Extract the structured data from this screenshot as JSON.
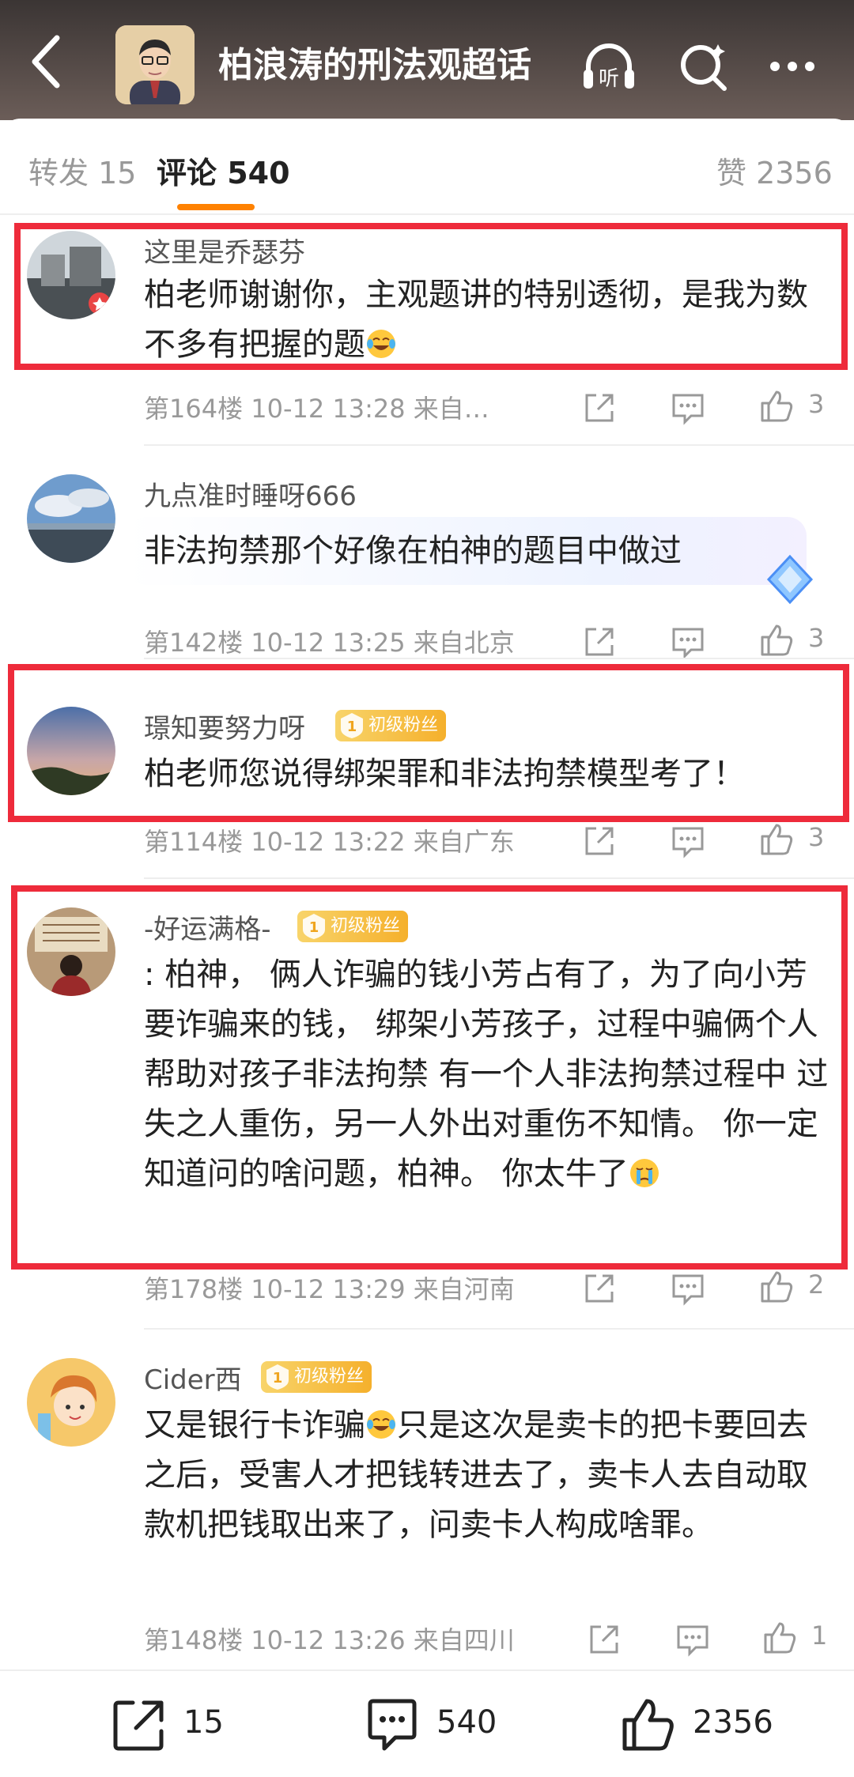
{
  "header": {
    "title": "柏浪涛的刑法观超话",
    "listen_label": "听"
  },
  "tabs": {
    "repost": "转发 15",
    "comment": "评论 540",
    "like": "赞 2356"
  },
  "comments": [
    {
      "username": "这里是乔瑟芬",
      "badge": "",
      "text": "柏老师谢谢你，主观题讲的特别透彻，是我为数不多有把握的题",
      "meta": "第164楼 10-12 13:28 来自…",
      "likes": "3"
    },
    {
      "username": "九点准时睡呀666",
      "badge": "",
      "text": "非法拘禁那个好像在柏神的题目中做过",
      "meta": "第142楼 10-12 13:25 来自北京",
      "likes": "3"
    },
    {
      "username": "璟知要努力呀",
      "badge": "初级粉丝",
      "badge_num": "1",
      "text": "柏老师您说得绑架罪和非法拘禁模型考了！",
      "meta": "第114楼 10-12 13:22 来自广东",
      "likes": "3"
    },
    {
      "username": "-好运满格-",
      "badge": "初级粉丝",
      "badge_num": "1",
      "text": ": 柏神，  俩人诈骗的钱小芳占有了，为了向小芳要诈骗来的钱，  绑架小芳孩子，过程中骗俩个人帮助对孩子非法拘禁      有一个人非法拘禁过程中 过失之人重伤，另一人外出对重伤不知情。      你一定知道问的啥问题，柏神。  你太牛了",
      "meta": "第178楼 10-12 13:29 来自河南",
      "likes": "2"
    },
    {
      "username": "Cider西",
      "badge": "初级粉丝",
      "badge_num": "1",
      "text_a": "又是银行卡诈骗",
      "text_b": "只是这次是卖卡的把卡要回去之后，受害人才把钱转进去了，卖卡人去自动取款机把钱取出来了，问卖卡人构成啥罪。",
      "meta": "第148楼 10-12 13:26 来自四川",
      "likes": "1"
    }
  ],
  "bottom": {
    "repost_count": "15",
    "comment_count": "540",
    "like_count": "2356"
  }
}
